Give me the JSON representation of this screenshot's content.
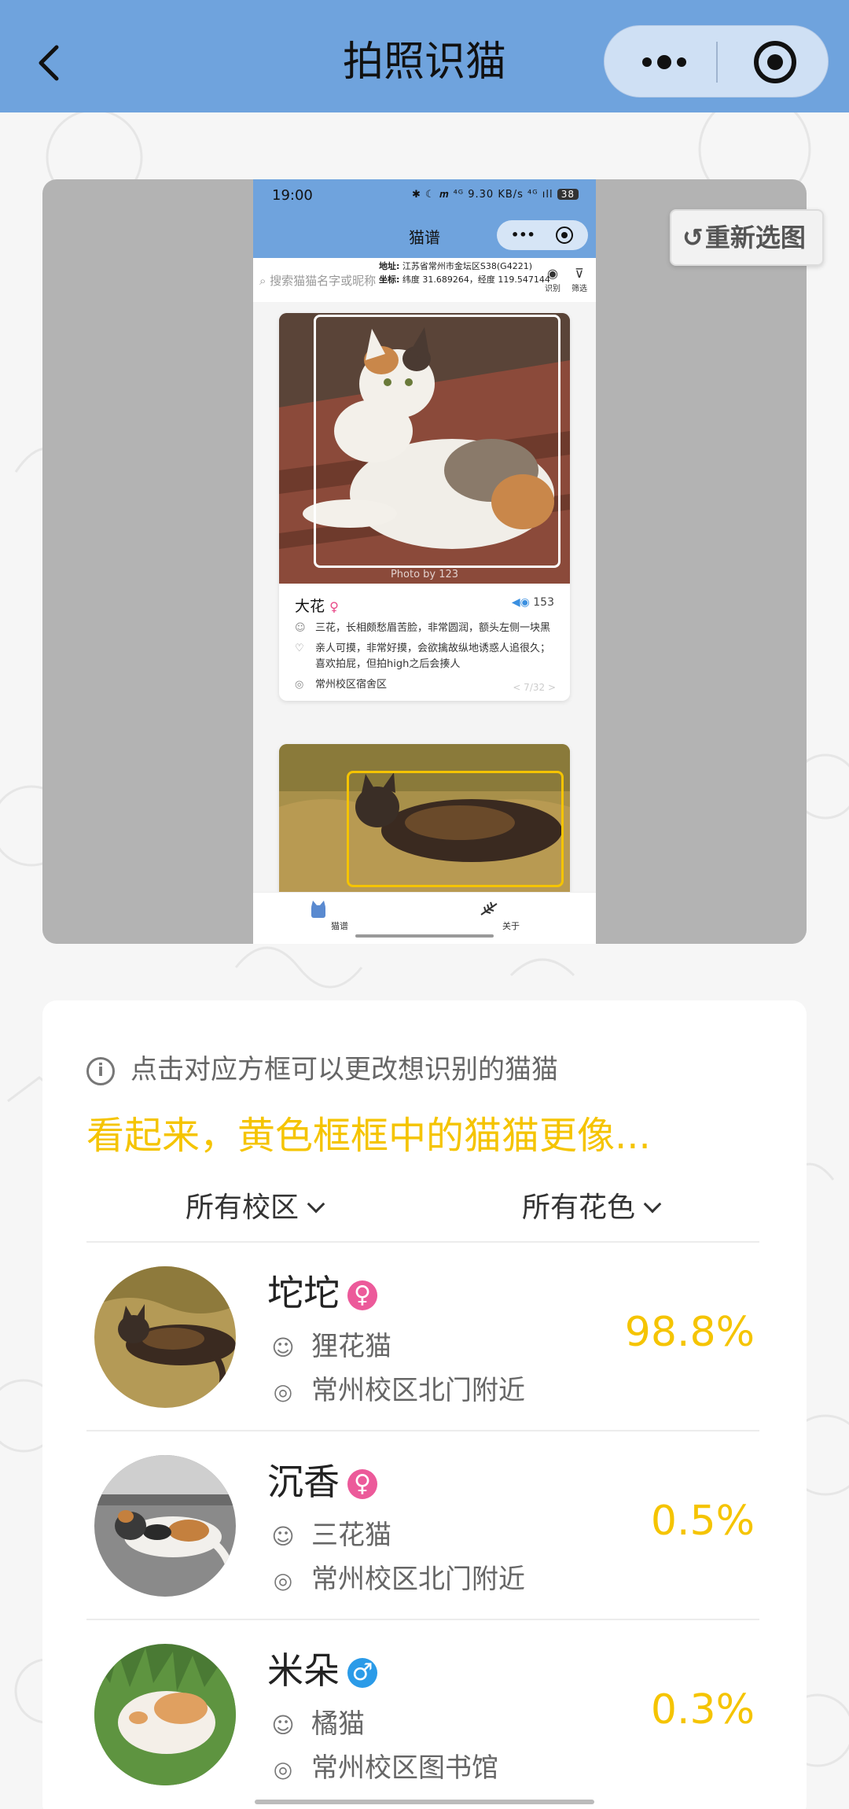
{
  "header": {
    "title": "拍照识猫",
    "back_icon": "chevron-left-icon",
    "menu_icon": "more-dots-icon",
    "close_icon": "target-circle-icon",
    "bg_color": "#6fa3dd"
  },
  "preview": {
    "reselect_label": "重新选图",
    "reselect_icon": "undo-arrow-icon",
    "phone": {
      "time": "19:00",
      "status_icons": "✱ ☾ 𝒎 ⁴ᴳ 9.30 KB/s ⁴ᴳ ıll",
      "battery": "38",
      "nav_title": "猫谱",
      "search_placeholder": "搜索猫猫名字或昵称",
      "location": {
        "addr_label": "地址:",
        "addr": "江苏省常州市金坛区S38(G4221)",
        "coord_label": "坐标:",
        "coord": "纬度 31.689264，经度 119.547144"
      },
      "tools": [
        {
          "label": "识别",
          "icon": "eye-icon"
        },
        {
          "label": "筛选",
          "icon": "filter-icon"
        }
      ],
      "card": {
        "photo_credit": "Photo by 123",
        "name": "大花",
        "gender": "♀",
        "likes": "153",
        "desc": "三花，长相颇愁眉苦脸，非常圆润，额头左侧一块黑",
        "personality": "亲人可摸，非常好摸，会欲擒故纵地诱惑人追很久；喜欢拍屁，但拍high之后会揍人",
        "location": "常州校区宿舍区",
        "page": "< 7/32 >"
      },
      "tabs": [
        {
          "label": "猫谱",
          "icon": "cat-icon"
        },
        {
          "label": "关于",
          "icon": "fishbone-icon"
        }
      ]
    }
  },
  "results": {
    "hint": "点击对应方框可以更改想识别的猫猫",
    "hint_icon": "info-icon",
    "headline": "看起来，黄色框框中的猫猫更像...",
    "filters": [
      {
        "label": "所有校区"
      },
      {
        "label": "所有花色"
      }
    ],
    "accent_color": "#f5c400",
    "items": [
      {
        "name": "坨坨",
        "gender": "♀",
        "gender_type": "female",
        "breed": "狸花猫",
        "location": "常州校区北门附近",
        "score": "98.8%"
      },
      {
        "name": "沉香",
        "gender": "♀",
        "gender_type": "female",
        "breed": "三花猫",
        "location": "常州校区北门附近",
        "score": "0.5%"
      },
      {
        "name": "米朵",
        "gender": "♂",
        "gender_type": "male",
        "breed": "橘猫",
        "location": "常州校区图书馆",
        "score": "0.3%"
      }
    ]
  }
}
